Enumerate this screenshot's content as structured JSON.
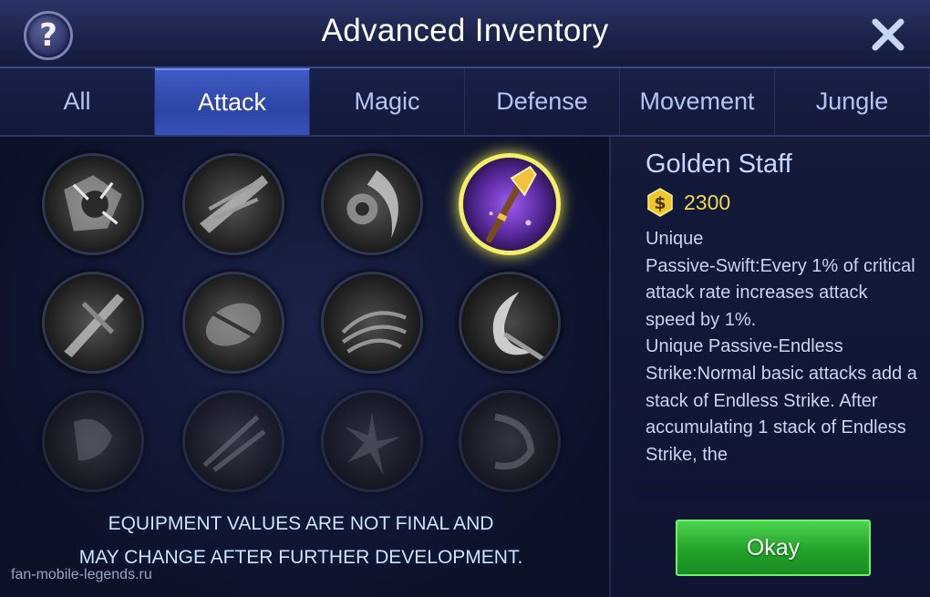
{
  "header": {
    "title": "Advanced Inventory",
    "help_glyph": "?",
    "help_icon": "question-mark-icon",
    "close_icon": "close-x-icon"
  },
  "tabs": [
    {
      "label": "All",
      "active": false
    },
    {
      "label": "Attack",
      "active": true
    },
    {
      "label": "Magic",
      "active": false
    },
    {
      "label": "Defense",
      "active": false
    },
    {
      "label": "Movement",
      "active": false
    },
    {
      "label": "Jungle",
      "active": false
    }
  ],
  "items": [
    {
      "icon": "attack-item-1-icon",
      "selected": false
    },
    {
      "icon": "attack-item-2-icon",
      "selected": false
    },
    {
      "icon": "attack-item-3-icon",
      "selected": false
    },
    {
      "icon": "golden-staff-icon",
      "selected": true
    },
    {
      "icon": "attack-item-5-icon",
      "selected": false
    },
    {
      "icon": "attack-item-6-icon",
      "selected": false
    },
    {
      "icon": "attack-item-7-icon",
      "selected": false
    },
    {
      "icon": "attack-item-8-icon",
      "selected": false
    },
    {
      "icon": "attack-item-9-icon",
      "selected": false
    },
    {
      "icon": "attack-item-10-icon",
      "selected": false
    },
    {
      "icon": "attack-item-11-icon",
      "selected": false
    },
    {
      "icon": "attack-item-12-icon",
      "selected": false
    }
  ],
  "notice": {
    "line1": "EQUIPMENT VALUES ARE NOT FINAL AND",
    "line2": "MAY CHANGE AFTER FURTHER DEVELOPMENT."
  },
  "watermark": "fan-mobile-legends.ru",
  "detail": {
    "name": "Golden Staff",
    "currency_icon": "gold-coin-icon",
    "price": "2300",
    "description": [
      "Unique",
      "Passive-Swift:Every 1% of critical attack rate increases attack speed by 1%.",
      "Unique Passive-Endless Strike:Normal basic attacks add a stack of Endless Strike. After accumulating 1 stack of Endless Strike, the"
    ],
    "okay_label": "Okay"
  },
  "colors": {
    "accent_tab": "#3f5cc6",
    "price_gold": "#f2d84d",
    "okay_green": "#23a32a",
    "selected_ring": "#f3ef6b"
  }
}
